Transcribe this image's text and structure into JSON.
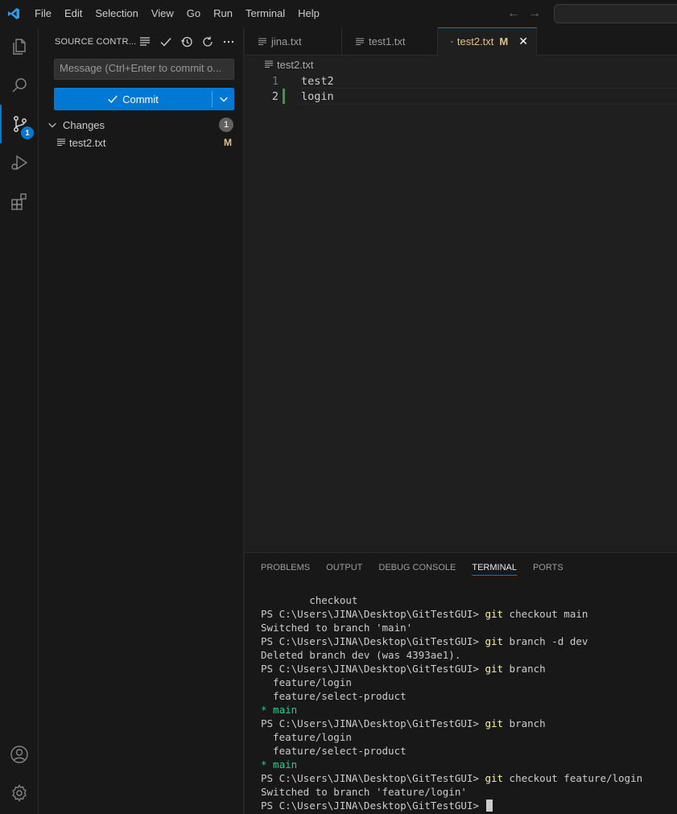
{
  "titlebar": {
    "menu": [
      "File",
      "Edit",
      "Selection",
      "View",
      "Go",
      "Run",
      "Terminal",
      "Help"
    ]
  },
  "activitybar": {
    "items": [
      {
        "icon": "explorer-icon"
      },
      {
        "icon": "search-icon"
      },
      {
        "icon": "source-control-icon",
        "badge": "1"
      },
      {
        "icon": "run-debug-icon"
      },
      {
        "icon": "extensions-icon"
      }
    ],
    "bottom": [
      {
        "icon": "account-icon"
      },
      {
        "icon": "settings-gear-icon"
      }
    ]
  },
  "sidebar": {
    "title": "SOURCE CONTR...",
    "message_placeholder": "Message (Ctrl+Enter to commit o...",
    "commit_label": "Commit",
    "changes_label": "Changes",
    "changes_count": "1",
    "files": [
      {
        "name": "test2.txt",
        "status": "M"
      }
    ]
  },
  "tabs": [
    {
      "label": "jina.txt",
      "active": false
    },
    {
      "label": "test1.txt",
      "active": false
    },
    {
      "label": "test2.txt",
      "active": true,
      "status": "M"
    }
  ],
  "breadcrumb": "test2.txt",
  "editor": {
    "lines": [
      {
        "number": "1",
        "text": "test2"
      },
      {
        "number": "2",
        "text": "login"
      }
    ]
  },
  "panel": {
    "tabs": [
      "PROBLEMS",
      "OUTPUT",
      "DEBUG CONSOLE",
      "TERMINAL",
      "PORTS"
    ],
    "active_tab": "TERMINAL"
  },
  "terminal": {
    "prompt": "PS C:\\Users\\JINA\\Desktop\\GitTestGUI>",
    "lines": [
      {
        "type": "out",
        "text": "        checkout"
      },
      {
        "type": "cmd",
        "cmd": "git",
        "args": " checkout main"
      },
      {
        "type": "out",
        "text": "Switched to branch 'main'"
      },
      {
        "type": "cmd",
        "cmd": "git",
        "args": " branch -d dev"
      },
      {
        "type": "out",
        "text": "Deleted branch dev (was 4393ae1)."
      },
      {
        "type": "cmd",
        "cmd": "git",
        "args": " branch"
      },
      {
        "type": "out",
        "text": "  feature/login"
      },
      {
        "type": "out",
        "text": "  feature/select-product"
      },
      {
        "type": "green",
        "text": "* main"
      },
      {
        "type": "cmd",
        "cmd": "git",
        "args": " branch"
      },
      {
        "type": "out",
        "text": "  feature/login"
      },
      {
        "type": "out",
        "text": "  feature/select-product"
      },
      {
        "type": "green",
        "text": "* main"
      },
      {
        "type": "cmd",
        "cmd": "git",
        "args": " checkout feature/login"
      },
      {
        "type": "out",
        "text": "Switched to branch 'feature/login'"
      },
      {
        "type": "prompt"
      }
    ]
  },
  "colors": {
    "accent": "#0078d4",
    "modified": "#e2c08d",
    "added_gutter": "#2ea043",
    "terminal_cmd": "#f9f1a5",
    "terminal_green": "#23d18b"
  }
}
